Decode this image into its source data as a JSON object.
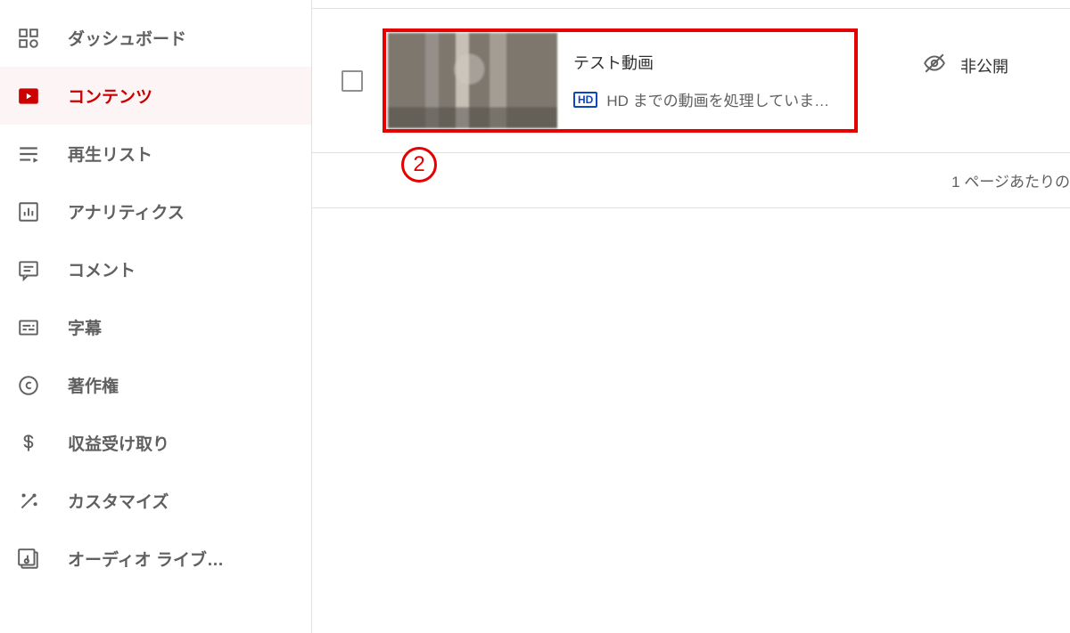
{
  "sidebar": {
    "items": [
      {
        "label": "ダッシュボード"
      },
      {
        "label": "コンテンツ"
      },
      {
        "label": "再生リスト"
      },
      {
        "label": "アナリティクス"
      },
      {
        "label": "コメント"
      },
      {
        "label": "字幕"
      },
      {
        "label": "著作権"
      },
      {
        "label": "収益受け取り"
      },
      {
        "label": "カスタマイズ"
      },
      {
        "label": "オーディオ ライブ…"
      }
    ]
  },
  "video": {
    "title": "テスト動画",
    "hd_badge": "HD",
    "status": "HD までの動画を処理していま…",
    "visibility_label": "非公開"
  },
  "pager": {
    "rows_label": "1 ページあたりの"
  },
  "callout": {
    "label": "2"
  }
}
